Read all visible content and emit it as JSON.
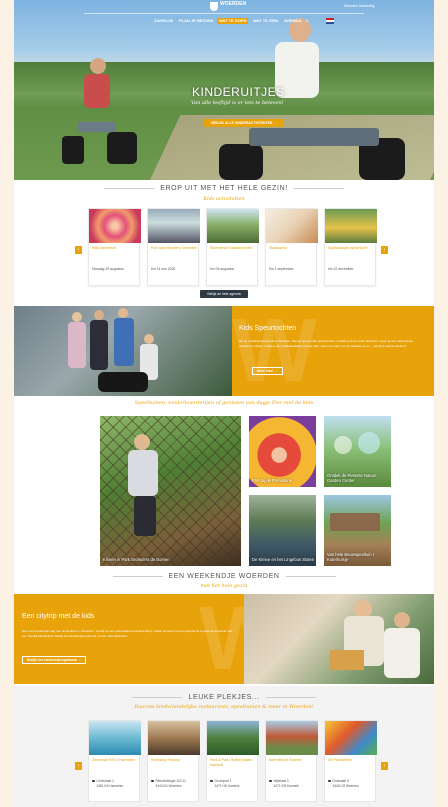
{
  "header": {
    "logo_text": "WOERDEN",
    "marketing_link": "Woerden Marketing",
    "nav": [
      "ZAKELIJK",
      "PLAN JE BEZOEK",
      "WAT TE DOEN",
      "WAT TE ZIEN",
      "AGENDA"
    ],
    "active_nav_index": 2
  },
  "hero": {
    "title": "KINDERUITJES",
    "subtitle": "Van alle leeftijd is er iets te beleven!",
    "button": "BEKIJK ALLE KINDERACTIVITEITEN"
  },
  "events": {
    "heading": "EROP UIT MET HET HELE GEZIN!",
    "script": "Kids activiteiten",
    "cards": [
      {
        "title": "Kids Adventure",
        "date": "Dinsdag 29 augustus"
      },
      {
        "title": "Film speurtochten | Woerden",
        "date": "t/m 14 mei 2025"
      },
      {
        "title": "Woerdense Bakseizoenen",
        "date": "t/m 03 augustus"
      },
      {
        "title": "Stadsspeur",
        "date": "t/m 1 september"
      },
      {
        "title": "Stadsbaasjes speurtocht",
        "date": "t/m 22 december"
      }
    ],
    "button": "Bekijk de hele agenda"
  },
  "speur": {
    "title": "Kids Speurtochten",
    "text": "Ga op ontdekkingstocht door Woerden. Met de spannende speurtochten, ontdekt je door Oude Woerden. Leren je over Woerdense verhalen en feiten, maak je een stadswandeling zonder gids, speel een spel, los de raadsels op en... wat jij de stad te bieden?",
    "button": "Meer info!"
  },
  "tiles": {
    "script": "Speeltuinen, kinderboerderijen of genieten van dagje Pier met de kids",
    "items": [
      {
        "caption": "Klimen in Park Bromders de Bomen"
      },
      {
        "caption": "Pret bij de Prehistorie"
      },
      {
        "caption": "Ontdek de Pieterse Nature Garden Center"
      },
      {
        "caption": "De Kleine en het Lingebos Sloten"
      },
      {
        "caption": "Van hele Bouwspeeltuin t Koterhuisje"
      }
    ]
  },
  "weekend": {
    "heading": "EEN WEEKENDJE WOERDEN",
    "script": "met het hele gezin",
    "title": "Een citytrip met de kids",
    "text": "Een cool weekendje weg met de kinderen in Woerden. Verblijf op een authentieke kinderboerderij, ontdek de stad met een speurtocht en sluit de avond af met een heerlijk familiediner. Bekijk het weekendprogramma en kom naar Woerden!",
    "button": "Bekijk het weekendprogramma"
  },
  "places": {
    "heading": "LEUKE PLEKJES...",
    "script": "Daarom kindvriendelijke restaurants, speeltuinen & meer in Woerden!",
    "cards": [
      {
        "title": "Zwembad H2O | Harmelen",
        "street": "Lichtstraat 1",
        "city": "3481 EA Harmelen"
      },
      {
        "title": "Workshop Factory",
        "street": "Rietveldsingel 120-11",
        "city": "3443 KK Woerden"
      },
      {
        "title": "Park & Pad | Buiten plaats Kamerik",
        "street": "Groenpad 1",
        "city": "3471 HD Kamerik"
      },
      {
        "title": "Boerderij de Bosmer",
        "street": "Wijstraat 3",
        "city": "3471 EM Kamerik"
      },
      {
        "title": "De Parkfabriek",
        "street": "Drossaart 9",
        "city": "3446 CH Woerden"
      }
    ]
  },
  "colors": {
    "accent": "#e8a20a",
    "dark": "#2e3a44"
  }
}
